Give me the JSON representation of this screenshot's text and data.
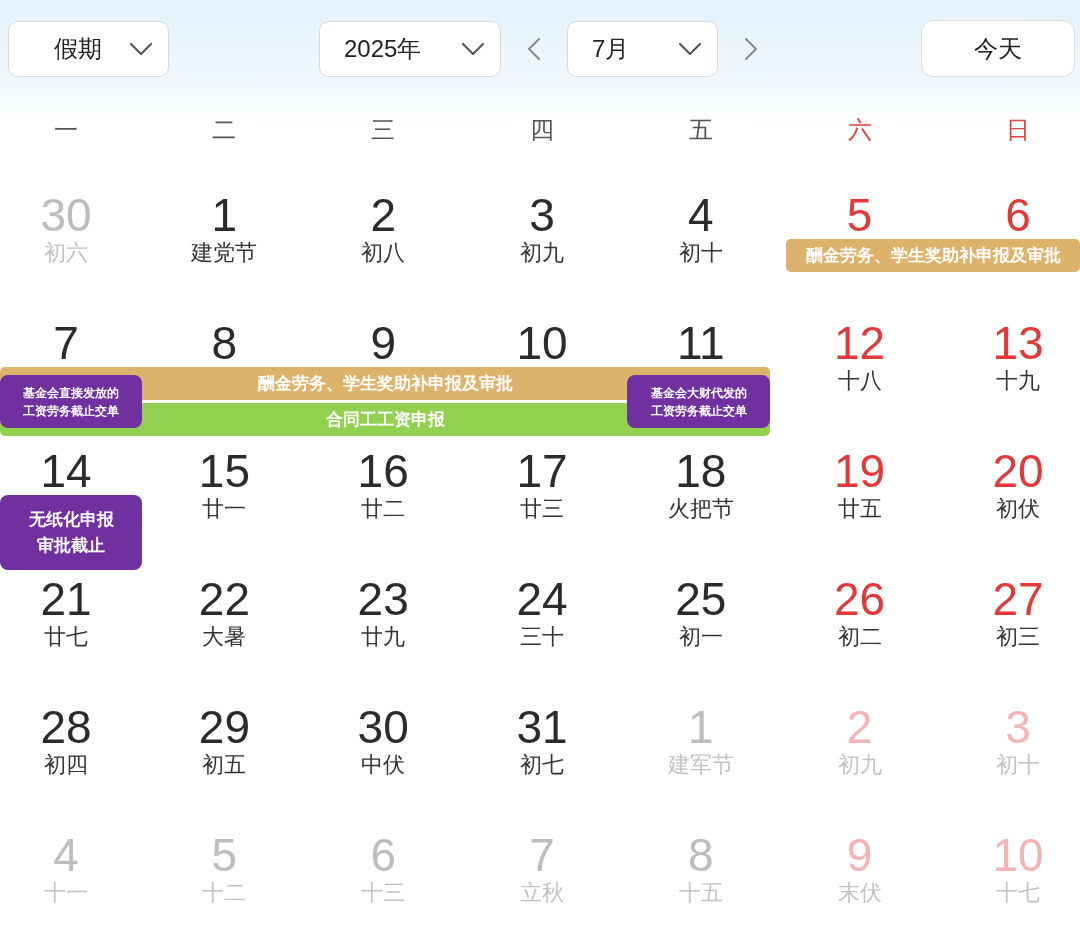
{
  "toolbar": {
    "holiday_select": {
      "value": "假期"
    },
    "year_select": {
      "value": "2025年"
    },
    "month_select": {
      "value": "7月"
    },
    "today_button": {
      "label": "今天"
    }
  },
  "weekdays": [
    {
      "label": "一",
      "weekend": false
    },
    {
      "label": "二",
      "weekend": false
    },
    {
      "label": "三",
      "weekend": false
    },
    {
      "label": "四",
      "weekend": false
    },
    {
      "label": "五",
      "weekend": false
    },
    {
      "label": "六",
      "weekend": true
    },
    {
      "label": "日",
      "weekend": true
    }
  ],
  "weeks": [
    {
      "groups": [
        {
          "days": [
            {
              "date": "30",
              "lunar": "初六",
              "other_month": true
            },
            {
              "date": "1",
              "lunar": "建党节",
              "other_month": false
            },
            {
              "date": "2",
              "lunar": "初八",
              "other_month": false
            },
            {
              "date": "3",
              "lunar": "初九",
              "other_month": false
            },
            {
              "date": "4",
              "lunar": "初十",
              "other_month": false
            }
          ]
        },
        {
          "days": [
            {
              "date": "5",
              "other_month": false
            },
            {
              "date": "6",
              "other_month": false
            }
          ],
          "bars": [
            {
              "label": "酬金劳务、学生奖助补申报及审批",
              "color": "#ddb36b"
            }
          ]
        }
      ]
    },
    {
      "groups": [
        {
          "days": [
            {
              "date": "7",
              "other_month": false,
              "notes": [
                {
                  "lines": [
                    "基金会直接发放的",
                    "工资劳务截止交单"
                  ],
                  "color": "#7030a0"
                }
              ]
            },
            {
              "date": "8",
              "other_month": false
            },
            {
              "date": "9",
              "other_month": false
            },
            {
              "date": "10",
              "other_month": false
            },
            {
              "date": "11",
              "other_month": false,
              "notes": [
                {
                  "lines": [
                    "基金会大财代发的",
                    "工资劳务截止交单"
                  ],
                  "color": "#7030a0"
                }
              ]
            }
          ],
          "bars": [
            {
              "label": "酬金劳务、学生奖助补申报及审批",
              "color": "#ddb36b"
            },
            {
              "label": "合同工工资申报",
              "color": "#92d050"
            }
          ]
        },
        {
          "days": [
            {
              "date": "12",
              "lunar": "十八",
              "other_month": false
            },
            {
              "date": "13",
              "lunar": "十九",
              "other_month": false
            }
          ]
        }
      ]
    },
    {
      "groups": [
        {
          "days": [
            {
              "date": "14",
              "other_month": false,
              "notes": [
                {
                  "lines": [
                    "无纸化申报",
                    "审批截止"
                  ],
                  "color": "#7030a0"
                }
              ]
            },
            {
              "date": "15",
              "lunar": "廿一",
              "other_month": false
            },
            {
              "date": "16",
              "lunar": "廿二",
              "other_month": false
            },
            {
              "date": "17",
              "lunar": "廿三",
              "other_month": false
            },
            {
              "date": "18",
              "lunar": "火把节",
              "other_month": false
            },
            {
              "date": "19",
              "lunar": "廿五",
              "other_month": false
            },
            {
              "date": "20",
              "lunar": "初伏",
              "other_month": false
            }
          ]
        }
      ]
    },
    {
      "groups": [
        {
          "days": [
            {
              "date": "21",
              "lunar": "廿七",
              "other_month": false
            },
            {
              "date": "22",
              "lunar": "大暑",
              "other_month": false
            },
            {
              "date": "23",
              "lunar": "廿九",
              "other_month": false
            },
            {
              "date": "24",
              "lunar": "三十",
              "other_month": false
            },
            {
              "date": "25",
              "lunar": "初一",
              "other_month": false
            },
            {
              "date": "26",
              "lunar": "初二",
              "other_month": false
            },
            {
              "date": "27",
              "lunar": "初三",
              "other_month": false
            }
          ]
        }
      ]
    },
    {
      "groups": [
        {
          "days": [
            {
              "date": "28",
              "lunar": "初四",
              "other_month": false
            },
            {
              "date": "29",
              "lunar": "初五",
              "other_month": false
            },
            {
              "date": "30",
              "lunar": "中伏",
              "other_month": false
            },
            {
              "date": "31",
              "lunar": "初七",
              "other_month": false
            },
            {
              "date": "1",
              "lunar": "建军节",
              "other_month": true
            },
            {
              "date": "2",
              "lunar": "初九",
              "other_month": true
            },
            {
              "date": "3",
              "lunar": "初十",
              "other_month": true
            }
          ]
        }
      ]
    },
    {
      "groups": [
        {
          "days": [
            {
              "date": "4",
              "lunar": "十一",
              "other_month": true
            },
            {
              "date": "5",
              "lunar": "十二",
              "other_month": true
            },
            {
              "date": "6",
              "lunar": "十三",
              "other_month": true
            },
            {
              "date": "7",
              "lunar": "立秋",
              "other_month": true
            },
            {
              "date": "8",
              "lunar": "十五",
              "other_month": true
            },
            {
              "date": "9",
              "lunar": "末伏",
              "other_month": true
            },
            {
              "date": "10",
              "lunar": "十七",
              "other_month": true
            }
          ]
        }
      ]
    }
  ]
}
